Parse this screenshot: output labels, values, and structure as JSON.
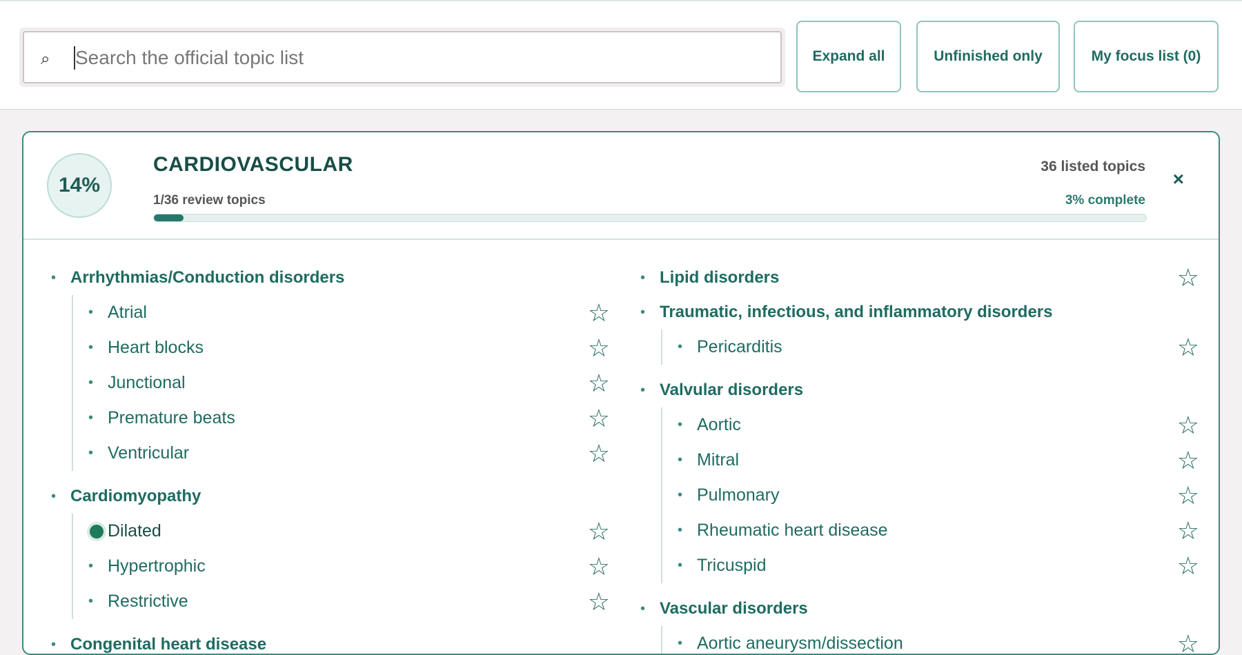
{
  "search": {
    "placeholder": "Search the official topic list",
    "value": "",
    "icon": "search-icon"
  },
  "toolbar": {
    "expand_all": "Expand all",
    "unfinished_only": "Unfinished only",
    "focus_list": "My focus list (0)"
  },
  "colors": {
    "accent": "#1f6b61",
    "border": "#3a8a7d",
    "done": "#1e7a5a"
  },
  "section": {
    "percent": "14%",
    "title": "CARDIOVASCULAR",
    "review_count": "1/36 review topics",
    "listed_count": "36 listed topics",
    "complete_text": "3% complete",
    "progress_fraction": 0.03,
    "close": "×"
  },
  "left_column": [
    {
      "label": "Arrhythmias/Conduction disorders",
      "starrable": false,
      "items": [
        {
          "label": "Atrial",
          "done": false
        },
        {
          "label": "Heart blocks",
          "done": false
        },
        {
          "label": "Junctional",
          "done": false
        },
        {
          "label": "Premature beats",
          "done": false
        },
        {
          "label": "Ventricular",
          "done": false
        }
      ]
    },
    {
      "label": "Cardiomyopathy",
      "starrable": false,
      "items": [
        {
          "label": "Dilated",
          "done": true
        },
        {
          "label": "Hypertrophic",
          "done": false
        },
        {
          "label": "Restrictive",
          "done": false
        }
      ]
    },
    {
      "label": "Congenital heart disease",
      "starrable": false,
      "items": []
    }
  ],
  "right_column": [
    {
      "label": "Lipid disorders",
      "starrable": true,
      "items": []
    },
    {
      "label": "Traumatic, infectious, and inflammatory disorders",
      "starrable": false,
      "items": [
        {
          "label": "Pericarditis",
          "done": false
        }
      ]
    },
    {
      "label": "Valvular disorders",
      "starrable": false,
      "items": [
        {
          "label": "Aortic",
          "done": false
        },
        {
          "label": "Mitral",
          "done": false
        },
        {
          "label": "Pulmonary",
          "done": false
        },
        {
          "label": "Rheumatic heart disease",
          "done": false
        },
        {
          "label": "Tricuspid",
          "done": false
        }
      ]
    },
    {
      "label": "Vascular disorders",
      "starrable": false,
      "items": [
        {
          "label": "Aortic aneurysm/dissection",
          "done": false
        }
      ]
    }
  ],
  "glyphs": {
    "bullet": "•",
    "star": "☆",
    "search": "⌕"
  }
}
